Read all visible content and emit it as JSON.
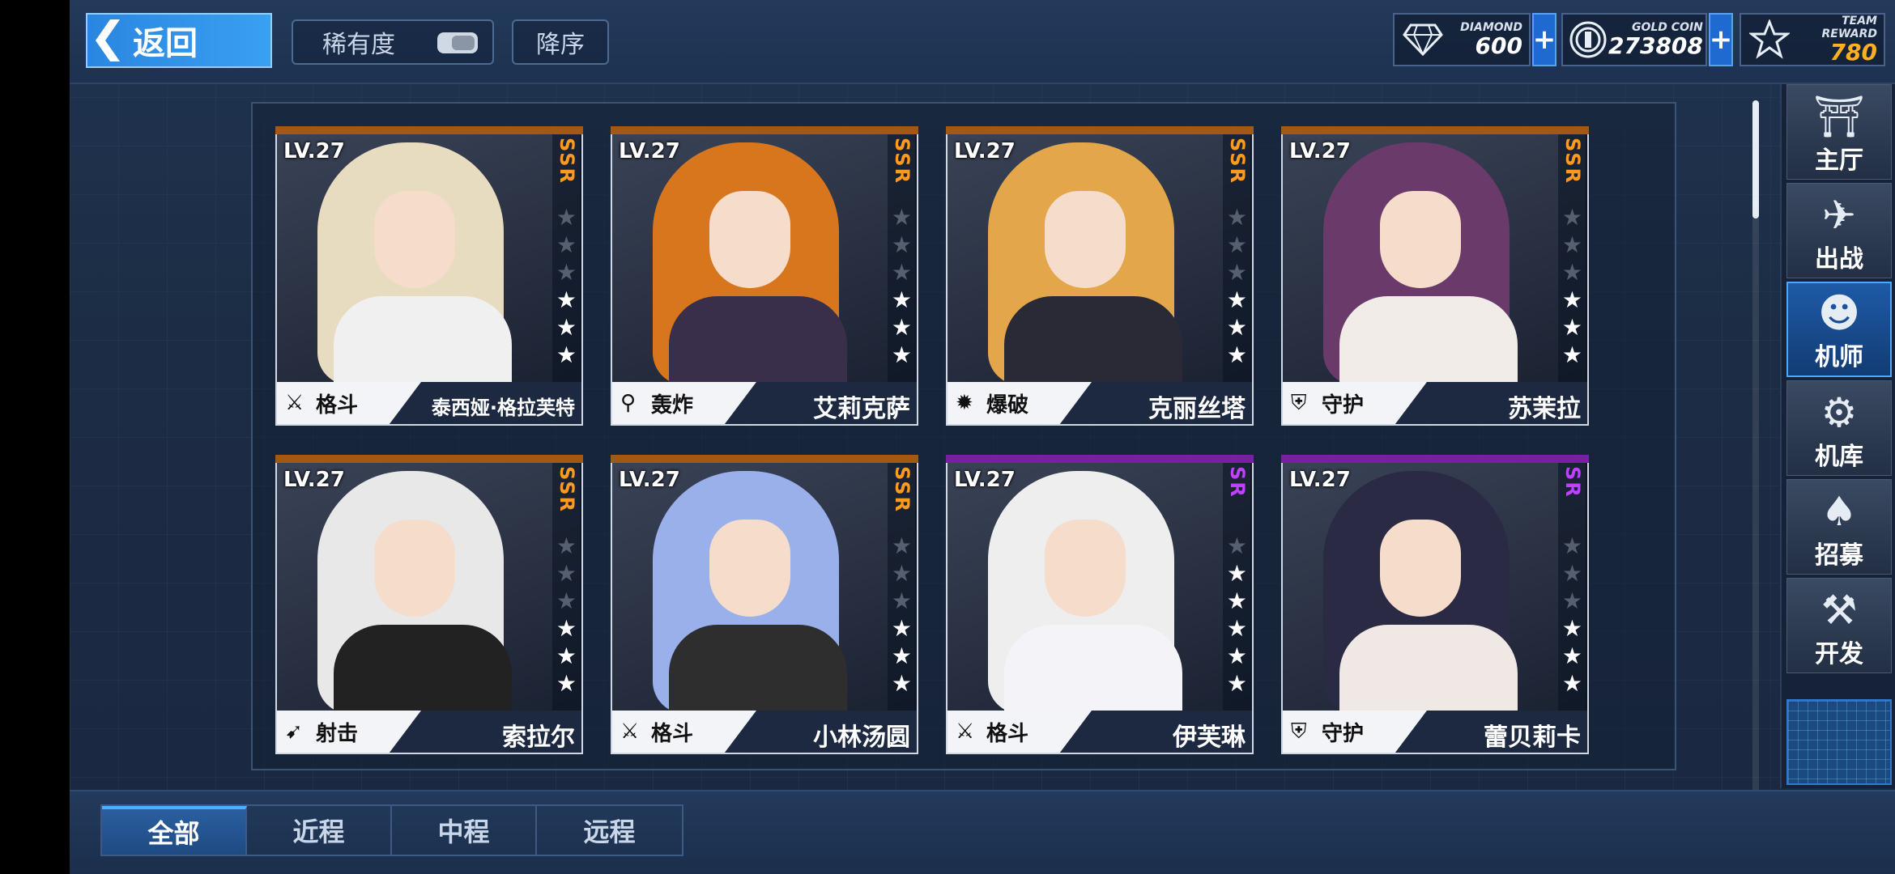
{
  "topbar": {
    "back_label": "返回",
    "sort_rarity_label": "稀有度",
    "sort_order_label": "降序",
    "currencies": [
      {
        "label": "DIAMOND",
        "value": "600",
        "icon": "diamond-icon"
      },
      {
        "label": "GOLD COIN",
        "value": "273808",
        "icon": "gold-coin-icon"
      },
      {
        "label": "TEAM REWARD",
        "value": "780",
        "icon": "team-reward-icon"
      }
    ],
    "plus": "+"
  },
  "cards": [
    {
      "level": "LV.27",
      "rarity": "SSR",
      "stars": 3,
      "class_label": "格斗",
      "class_icon": "crossed-swords-icon",
      "name": "泰西娅·格拉芙特",
      "hair": "#e8dcc0",
      "body": "#f0f0f0"
    },
    {
      "level": "LV.27",
      "rarity": "SSR",
      "stars": 3,
      "class_label": "轰炸",
      "class_icon": "mortar-icon",
      "name": "艾莉克萨",
      "hair": "#d8761e",
      "body": "#3a2f4a"
    },
    {
      "level": "LV.27",
      "rarity": "SSR",
      "stars": 3,
      "class_label": "爆破",
      "class_icon": "explosive-icon",
      "name": "克丽丝塔",
      "hair": "#e3a64a",
      "body": "#2a2a36"
    },
    {
      "level": "LV.27",
      "rarity": "SSR",
      "stars": 3,
      "class_label": "守护",
      "class_icon": "shield-icon",
      "name": "苏茉拉",
      "hair": "#6a3a6a",
      "body": "#f2ece8"
    },
    {
      "level": "LV.27",
      "rarity": "SSR",
      "stars": 3,
      "class_label": "射击",
      "class_icon": "rifle-icon",
      "name": "索拉尔",
      "hair": "#e8e8e8",
      "body": "#222"
    },
    {
      "level": "LV.27",
      "rarity": "SSR",
      "stars": 3,
      "class_label": "格斗",
      "class_icon": "crossed-swords-icon",
      "name": "小林汤圆",
      "hair": "#9ab0ea",
      "body": "#2e2e2e"
    },
    {
      "level": "LV.27",
      "rarity": "SR",
      "stars": 5,
      "class_label": "格斗",
      "class_icon": "crossed-swords-icon",
      "name": "伊芙琳",
      "hair": "#eeeeee",
      "body": "#f4f4f8"
    },
    {
      "level": "LV.27",
      "rarity": "SR",
      "stars": 3,
      "class_label": "守护",
      "class_icon": "shield-icon",
      "name": "蕾贝莉卡",
      "hair": "#2a2a44",
      "body": "#f0e8e4"
    }
  ],
  "tabs": [
    {
      "label": "全部",
      "active": true
    },
    {
      "label": "近程",
      "active": false
    },
    {
      "label": "中程",
      "active": false
    },
    {
      "label": "远程",
      "active": false
    }
  ],
  "sidebar": [
    {
      "label": "主厅",
      "icon": "lobby-icon",
      "glyph": "⛩",
      "active": false
    },
    {
      "label": "出战",
      "icon": "battle-mech-icon",
      "glyph": "✈",
      "active": false
    },
    {
      "label": "机师",
      "icon": "pilot-icon",
      "glyph": "☻",
      "active": true
    },
    {
      "label": "机库",
      "icon": "hangar-icon",
      "glyph": "⚙",
      "active": false
    },
    {
      "label": "招募",
      "icon": "recruit-card-icon",
      "glyph": "♠",
      "active": false
    },
    {
      "label": "开发",
      "icon": "develop-icon",
      "glyph": "⚒",
      "active": false
    }
  ]
}
